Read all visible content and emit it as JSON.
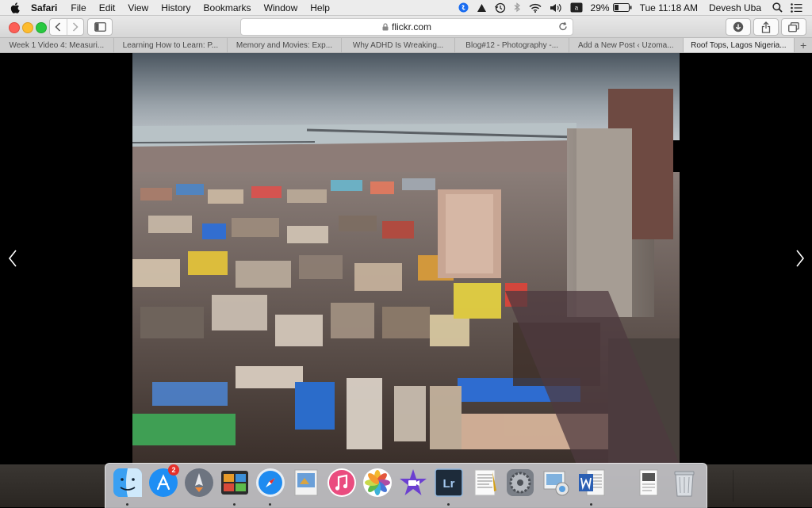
{
  "menubar": {
    "app": "Safari",
    "menus": [
      "File",
      "Edit",
      "View",
      "History",
      "Bookmarks",
      "Window",
      "Help"
    ],
    "battery": "29%",
    "clock": "Tue 11:18 AM",
    "user": "Devesh Uba"
  },
  "toolbar": {
    "url": "flickr.com"
  },
  "tabs": [
    {
      "label": "Week 1 Video 4: Measuri..."
    },
    {
      "label": "Learning How to Learn: P..."
    },
    {
      "label": "Memory and Movies: Exp..."
    },
    {
      "label": "Why ADHD Is Wreaking..."
    },
    {
      "label": "Blog#12 - Photography -..."
    },
    {
      "label": "Add a New Post ‹ Uzoma..."
    },
    {
      "label": "Roof Tops, Lagos Nigeria..."
    }
  ],
  "tab_add": "+",
  "viewer": {
    "photo_icon": "city-rooftops-photo"
  },
  "dock": {
    "app_store_badge": "2",
    "lightroom_label": "Lr",
    "items": [
      "finder-icon",
      "app-store-icon",
      "launchpad-icon",
      "photo-booth-icon",
      "safari-icon",
      "preview-icon",
      "itunes-icon",
      "photos-icon",
      "imovie-icon",
      "lightroom-icon",
      "textedit-icon",
      "system-preferences-icon",
      "image-capture-icon",
      "word-icon",
      "document-icon",
      "trash-icon"
    ]
  }
}
